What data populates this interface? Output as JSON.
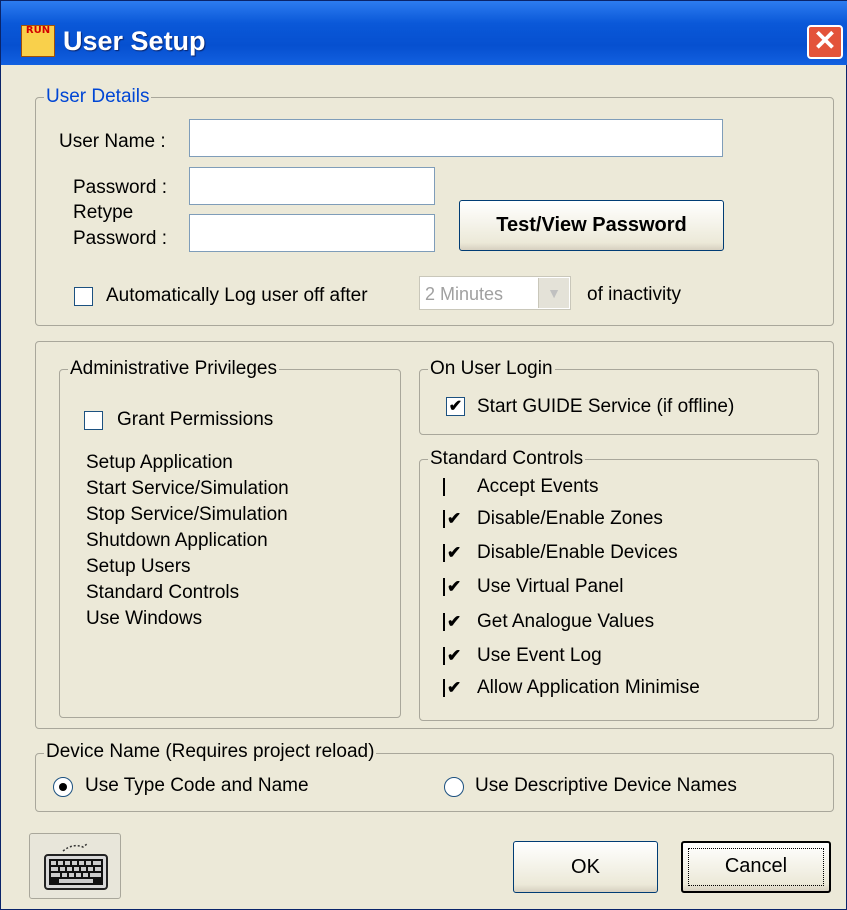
{
  "window": {
    "title": "User Setup",
    "app_icon_text": "RUN"
  },
  "user_details": {
    "legend": "User Details",
    "user_name_label": "User Name :",
    "user_name_value": "",
    "password_label": "Password :",
    "password_value": "",
    "retype_label_1": "Retype",
    "retype_label_2": "Password :",
    "retype_value": "",
    "test_view_button": "Test/View Password",
    "auto_logoff_label": "Automatically Log user off after",
    "auto_logoff_checked": false,
    "auto_logoff_select": "2 Minutes",
    "inactivity_label": "of inactivity"
  },
  "admin": {
    "legend": "Administrative Privileges",
    "grant_label": "Grant Permissions",
    "grant_checked": false,
    "items": [
      "Setup Application",
      "Start Service/Simulation",
      "Stop Service/Simulation",
      "Shutdown Application",
      "Setup Users",
      "Standard Controls",
      "Use Windows"
    ]
  },
  "on_login": {
    "legend": "On User Login",
    "start_guide_label": "Start GUIDE Service (if offline)",
    "start_guide_checked": true
  },
  "standard_controls": {
    "legend": "Standard Controls",
    "items": [
      {
        "label": "Accept Events",
        "checked": false
      },
      {
        "label": "Disable/Enable Zones",
        "checked": true
      },
      {
        "label": "Disable/Enable Devices",
        "checked": true
      },
      {
        "label": "Use Virtual Panel",
        "checked": true
      },
      {
        "label": "Get Analogue Values",
        "checked": true
      },
      {
        "label": "Use Event Log",
        "checked": true
      },
      {
        "label": "Allow Application Minimise",
        "checked": true
      }
    ]
  },
  "device_name": {
    "legend": "Device Name (Requires project reload)",
    "option_type_code": "Use Type Code and Name",
    "option_descriptive": "Use Descriptive Device Names",
    "selected": "type_code"
  },
  "footer": {
    "ok": "OK",
    "cancel": "Cancel"
  },
  "icons": {
    "close": "close-icon",
    "keyboard": "keyboard-icon",
    "check": "✔"
  },
  "colors": {
    "title_bar": "#0a58d8",
    "legend_text": "#0046d5",
    "close_button": "#e3533a"
  }
}
